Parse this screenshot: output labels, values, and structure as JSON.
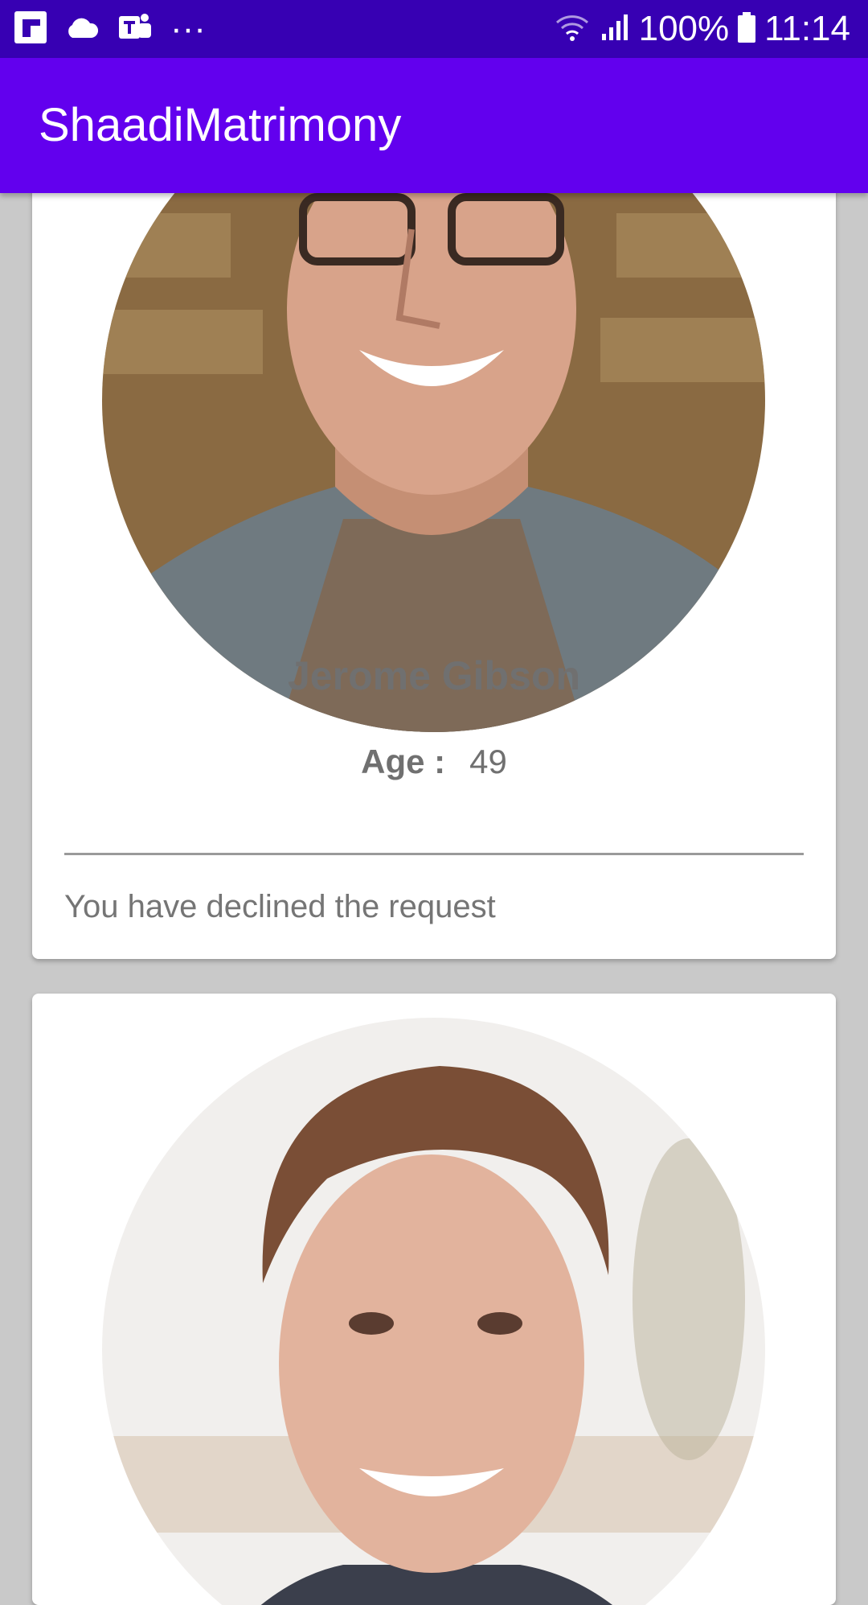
{
  "status_bar": {
    "icons_left": [
      "flipboard-icon",
      "cloud-icon",
      "teams-icon",
      "more-dots-icon"
    ],
    "more_dots": "···",
    "battery": "100%",
    "time": "11:14"
  },
  "app_bar": {
    "title": "ShaadiMatrimony"
  },
  "profiles": [
    {
      "name": "Jerome Gibson",
      "age_label": "Age :",
      "age": "49",
      "status": "You have declined the request"
    },
    {}
  ],
  "colors": {
    "status_bar": "#3700b3",
    "app_bar": "#6200ee",
    "background": "#c9c9c9",
    "card": "#ffffff",
    "text_gray": "#707070"
  }
}
